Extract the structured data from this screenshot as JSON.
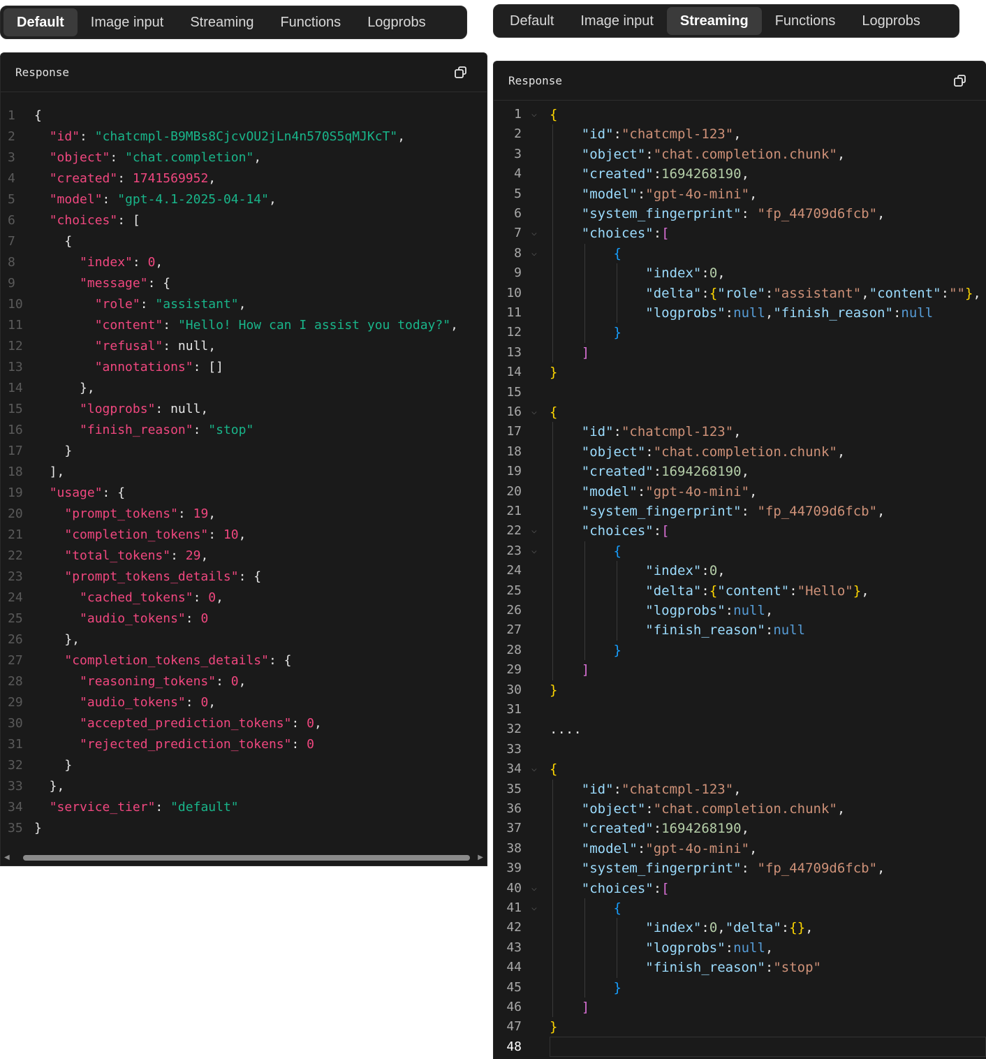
{
  "tabs_left": {
    "items": [
      "Default",
      "Image input",
      "Streaming",
      "Functions",
      "Logprobs"
    ],
    "active": 0
  },
  "tabs_right": {
    "items": [
      "Default",
      "Image input",
      "Streaming",
      "Functions",
      "Logprobs"
    ],
    "active": 2
  },
  "left_panel": {
    "title": "Response",
    "copy_icon": "copy-icon",
    "lines": [
      "{",
      "  \"id\": \"chatcmpl-B9MBs8CjcvOU2jLn4n570S5qMJKcT\",",
      "  \"object\": \"chat.completion\",",
      "  \"created\": 1741569952,",
      "  \"model\": \"gpt-4.1-2025-04-14\",",
      "  \"choices\": [",
      "    {",
      "      \"index\": 0,",
      "      \"message\": {",
      "        \"role\": \"assistant\",",
      "        \"content\": \"Hello! How can I assist you today?\",",
      "        \"refusal\": null,",
      "        \"annotations\": []",
      "      },",
      "      \"logprobs\": null,",
      "      \"finish_reason\": \"stop\"",
      "    }",
      "  ],",
      "  \"usage\": {",
      "    \"prompt_tokens\": 19,",
      "    \"completion_tokens\": 10,",
      "    \"total_tokens\": 29,",
      "    \"prompt_tokens_details\": {",
      "      \"cached_tokens\": 0,",
      "      \"audio_tokens\": 0",
      "    },",
      "    \"completion_tokens_details\": {",
      "      \"reasoning_tokens\": 0,",
      "      \"audio_tokens\": 0,",
      "      \"accepted_prediction_tokens\": 0,",
      "      \"rejected_prediction_tokens\": 0",
      "    }",
      "  },",
      "  \"service_tier\": \"default\"",
      "}"
    ]
  },
  "right_panel": {
    "title": "Response",
    "copy_icon": "copy-icon",
    "lines": [
      "{",
      "    \"id\":\"chatcmpl-123\",",
      "    \"object\":\"chat.completion.chunk\",",
      "    \"created\":1694268190,",
      "    \"model\":\"gpt-4o-mini\",",
      "    \"system_fingerprint\": \"fp_44709d6fcb\",",
      "    \"choices\":[",
      "        {",
      "            \"index\":0,",
      "            \"delta\":{\"role\":\"assistant\",\"content\":\"\"},",
      "            \"logprobs\":null,\"finish_reason\":null",
      "        }",
      "    ]",
      "}",
      "",
      "{",
      "    \"id\":\"chatcmpl-123\",",
      "    \"object\":\"chat.completion.chunk\",",
      "    \"created\":1694268190,",
      "    \"model\":\"gpt-4o-mini\",",
      "    \"system_fingerprint\": \"fp_44709d6fcb\",",
      "    \"choices\":[",
      "        {",
      "            \"index\":0,",
      "            \"delta\":{\"content\":\"Hello\"},",
      "            \"logprobs\":null,",
      "            \"finish_reason\":null",
      "        }",
      "    ]",
      "}",
      "",
      "....",
      "",
      "{",
      "    \"id\":\"chatcmpl-123\",",
      "    \"object\":\"chat.completion.chunk\",",
      "    \"created\":1694268190,",
      "    \"model\":\"gpt-4o-mini\",",
      "    \"system_fingerprint\": \"fp_44709d6fcb\",",
      "    \"choices\":[",
      "        {",
      "            \"index\":0,\"delta\":{},",
      "            \"logprobs\":null,",
      "            \"finish_reason\":\"stop\"",
      "        }",
      "    ]",
      "}",
      ""
    ],
    "fold_lines": [
      1,
      7,
      8,
      16,
      22,
      23,
      34,
      40,
      41
    ]
  },
  "colors": {
    "panel_bg": "#1a1a1a",
    "left_key": "#f0477f",
    "left_string": "#19b58a",
    "left_null": "#2f8ce8",
    "right_key": "#9cdcfe",
    "right_string": "#ce9178",
    "right_number": "#b5cea8"
  }
}
